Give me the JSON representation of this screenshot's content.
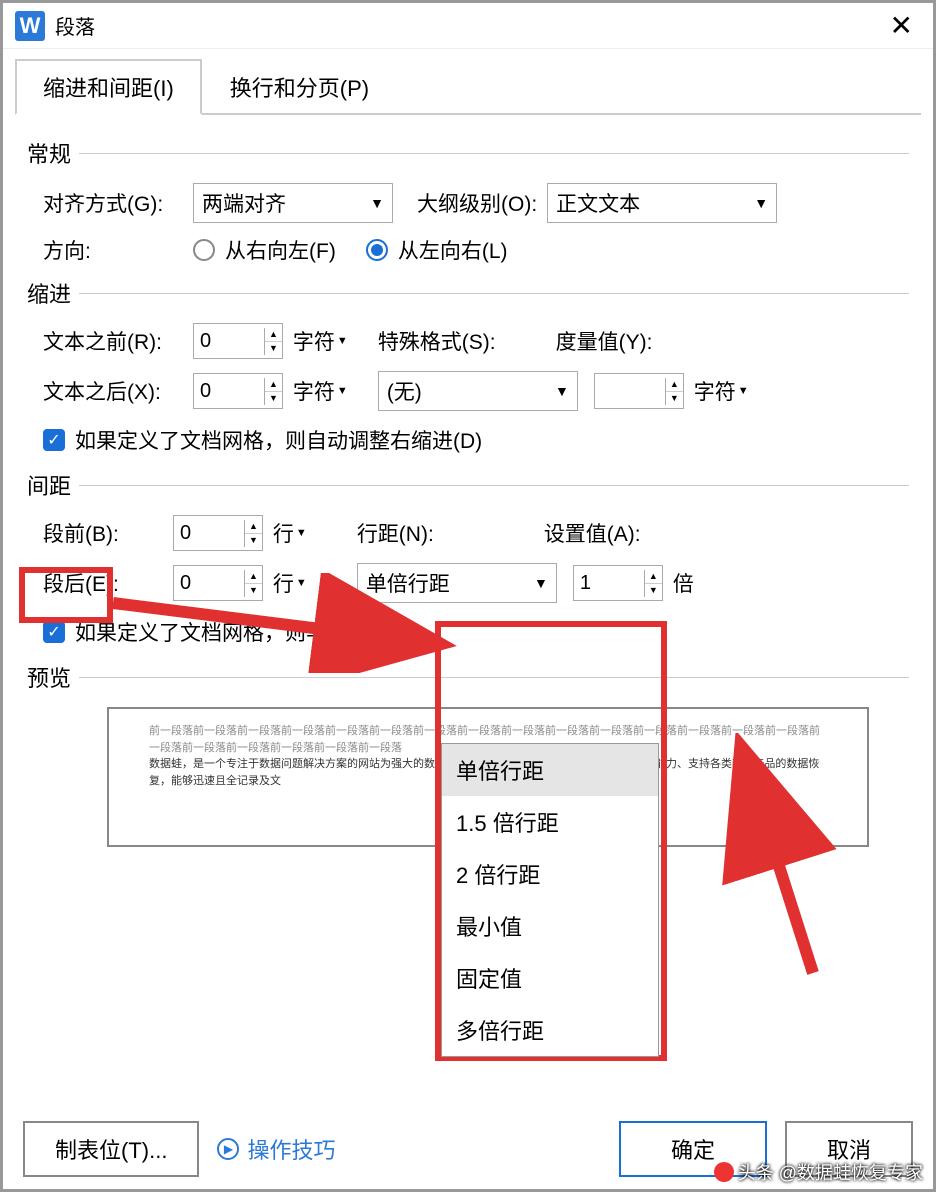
{
  "title": "段落",
  "tabs": {
    "indent": "缩进和间距(I)",
    "pagebreak": "换行和分页(P)"
  },
  "general": {
    "heading": "常规",
    "align_label": "对齐方式(G):",
    "align_value": "两端对齐",
    "outline_label": "大纲级别(O):",
    "outline_value": "正文文本",
    "direction_label": "方向:",
    "rtl": "从右向左(F)",
    "ltr": "从左向右(L)"
  },
  "indent": {
    "heading": "缩进",
    "before_label": "文本之前(R):",
    "before_value": "0",
    "after_label": "文本之后(X):",
    "after_value": "0",
    "char_unit": "字符",
    "special_label": "特殊格式(S):",
    "special_value": "(无)",
    "measure_label": "度量值(Y):",
    "measure_value": "",
    "grid_check": "如果定义了文档网格，则自动调整右缩进(D)"
  },
  "spacing": {
    "heading": "间距",
    "before_label": "段前(B):",
    "before_value": "0",
    "after_label": "段后(E):",
    "after_value": "0",
    "line_unit": "行",
    "linespace_label": "行距(N):",
    "linespace_value": "单倍行距",
    "setvalue_label": "设置值(A):",
    "setvalue_value": "1",
    "setvalue_unit": "倍",
    "grid_check": "如果定义了文档网格，则与",
    "options": [
      "单倍行距",
      "1.5 倍行距",
      "2 倍行距",
      "最小值",
      "固定值",
      "多倍行距"
    ]
  },
  "preview": {
    "heading": "预览",
    "gray1": "前一段落前一段落前一段落前一段落前一段落前一段落前一段落前一段落前一段落前一段落前一段落前一段落前一段落前一段落前一段落前一段落前一段落前一段落前一段落前一段落前一段落",
    "dark": "数据蛙，是一个专注于数据问题解决方案的网站为强大的数据分析引擎支撑，具备对各类磁介、格式处理能力、支持各类iOS 产品的数据恢复，能够迅速且全记录及文",
    "gray2": ""
  },
  "footer": {
    "tabstop": "制表位(T)...",
    "tips": "操作技巧",
    "ok": "确定",
    "cancel": "取消"
  },
  "watermark": "头条 @数据蛙恢复专家"
}
